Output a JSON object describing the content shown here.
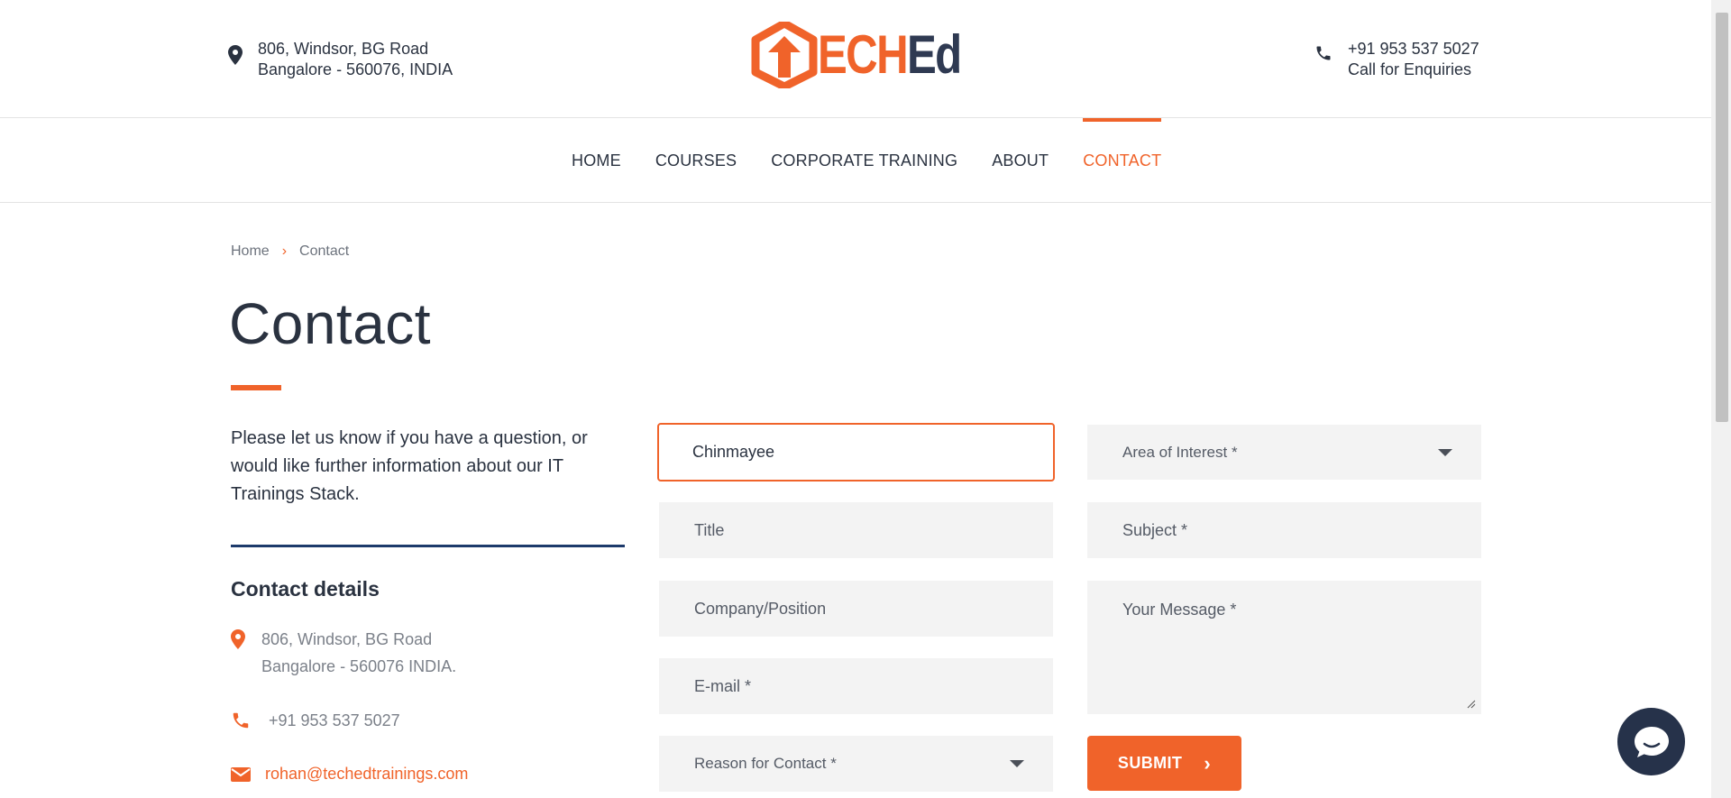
{
  "header": {
    "address_line1": "806, Windsor, BG Road",
    "address_line2": "Bangalore - 560076, INDIA",
    "phone": "+91 953 537 5027",
    "phone_caption": "Call for Enquiries",
    "logo_text_orange": "ECH",
    "logo_text_dark": "Ed",
    "brand_color": "#f0632a",
    "dark_color": "#2f3a52"
  },
  "nav": {
    "items": [
      {
        "label": "HOME",
        "active": false
      },
      {
        "label": "COURSES",
        "active": false
      },
      {
        "label": "CORPORATE TRAINING",
        "active": false
      },
      {
        "label": "ABOUT",
        "active": false
      },
      {
        "label": "CONTACT",
        "active": true
      }
    ]
  },
  "breadcrumb": {
    "home": "Home",
    "separator": "›",
    "current": "Contact"
  },
  "page": {
    "title": "Contact",
    "intro": "Please let us know if you have a question, or would like further information about our IT Trainings Stack."
  },
  "contact_details": {
    "title": "Contact details",
    "address_line1": "806, Windsor, BG Road",
    "address_line2": "Bangalore - 560076 INDIA.",
    "phone": "+91 953 537 5027",
    "email": "rohan@techedtrainings.com"
  },
  "form": {
    "name_value": "Chinmayee",
    "title_placeholder": "Title",
    "company_placeholder": "Company/Position",
    "email_placeholder": "E-mail *",
    "reason_placeholder": "Reason for Contact *",
    "area_placeholder": "Area of Interest *",
    "subject_placeholder": "Subject *",
    "message_placeholder": "Your Message *",
    "submit_label": "SUBMIT",
    "submit_chevron": "›"
  },
  "icons": {
    "location": "map-pin-icon",
    "phone": "phone-icon",
    "email": "envelope-icon",
    "chat": "chat-bubble-icon"
  }
}
